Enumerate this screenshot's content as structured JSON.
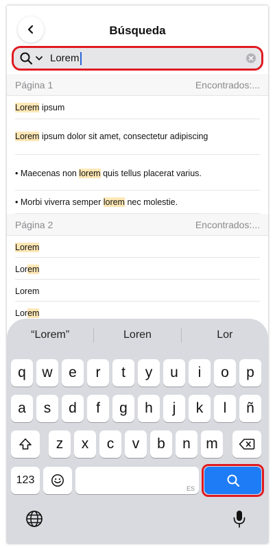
{
  "header": {
    "title": "Búsqueda"
  },
  "search": {
    "query": "Lorem"
  },
  "results": {
    "pages": [
      {
        "label": "Página 1",
        "found": "Encontrados:...",
        "rows": [
          {
            "match": "Lorem",
            "rest": " ipsum",
            "prefix": ""
          },
          {
            "match": "Lorem",
            "rest": " ipsum dolor sit amet, consectetur adipiscing",
            "prefix": ""
          },
          {
            "prefix": "• Maecenas non ",
            "match": "lorem",
            "rest": " quis tellus placerat varius."
          },
          {
            "prefix": "• Morbi viverra semper ",
            "match": "lorem",
            "rest": " nec molestie."
          }
        ]
      },
      {
        "label": "Página 2",
        "found": "Encontrados:...",
        "rows": [
          {
            "match": "Lorem"
          },
          {
            "plain": "Lor",
            "match": "em"
          },
          {
            "text": "Lorem"
          },
          {
            "plain": "Lor",
            "match": "em"
          }
        ]
      }
    ]
  },
  "keyboard": {
    "suggestions": [
      "“Lorem”",
      "Loren",
      "Lor"
    ],
    "row1": [
      "q",
      "w",
      "e",
      "r",
      "t",
      "y",
      "u",
      "i",
      "o",
      "p"
    ],
    "row2": [
      "a",
      "s",
      "d",
      "f",
      "g",
      "h",
      "j",
      "k",
      "l",
      "ñ"
    ],
    "row3": [
      "z",
      "x",
      "c",
      "v",
      "b",
      "n",
      "m"
    ],
    "numbers_label": "123",
    "space_lang": "ES"
  }
}
